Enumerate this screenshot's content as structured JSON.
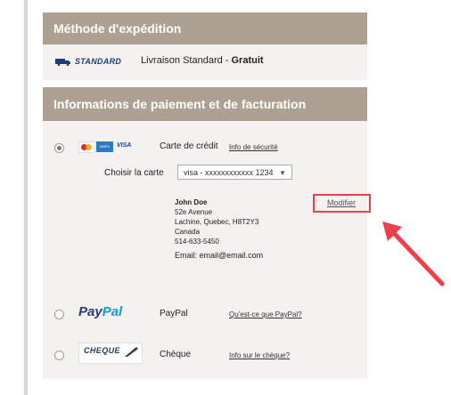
{
  "shipping": {
    "header": "Méthode d'expédition",
    "logo_text": "STANDARD",
    "method_text": "Livraison Standard - ",
    "price_text": "Gratuit"
  },
  "payment": {
    "header": "Informations de paiement et de facturation",
    "credit_card": {
      "label": "Carte de crédit",
      "security_link": "Info de sécurité",
      "choose_label": "Choisir la carte",
      "selected_card": "visa - xxxxxxxxxxxx 1234",
      "selected": true
    },
    "address": {
      "name": "John Doe",
      "street": "52e Avenue",
      "city_line": "Lachine, Quebec, H8T2Y3",
      "country": "Canada",
      "phone": "514-633-5450",
      "email_label": "Email: ",
      "email": "email@email.com"
    },
    "modify_link": "Modifier",
    "paypal": {
      "logo_pay": "Pay",
      "logo_pal": "Pal",
      "label": "PayPal",
      "link": "Qu'est-ce que PayPal?"
    },
    "cheque": {
      "logo_text": "CHEQUE",
      "label": "Chèque",
      "link": "Info sur le chèque?"
    }
  },
  "colors": {
    "header_bg": "#aca193",
    "highlight": "#ef3f4c",
    "paypal_dark": "#253b80",
    "paypal_light": "#179bd7"
  }
}
